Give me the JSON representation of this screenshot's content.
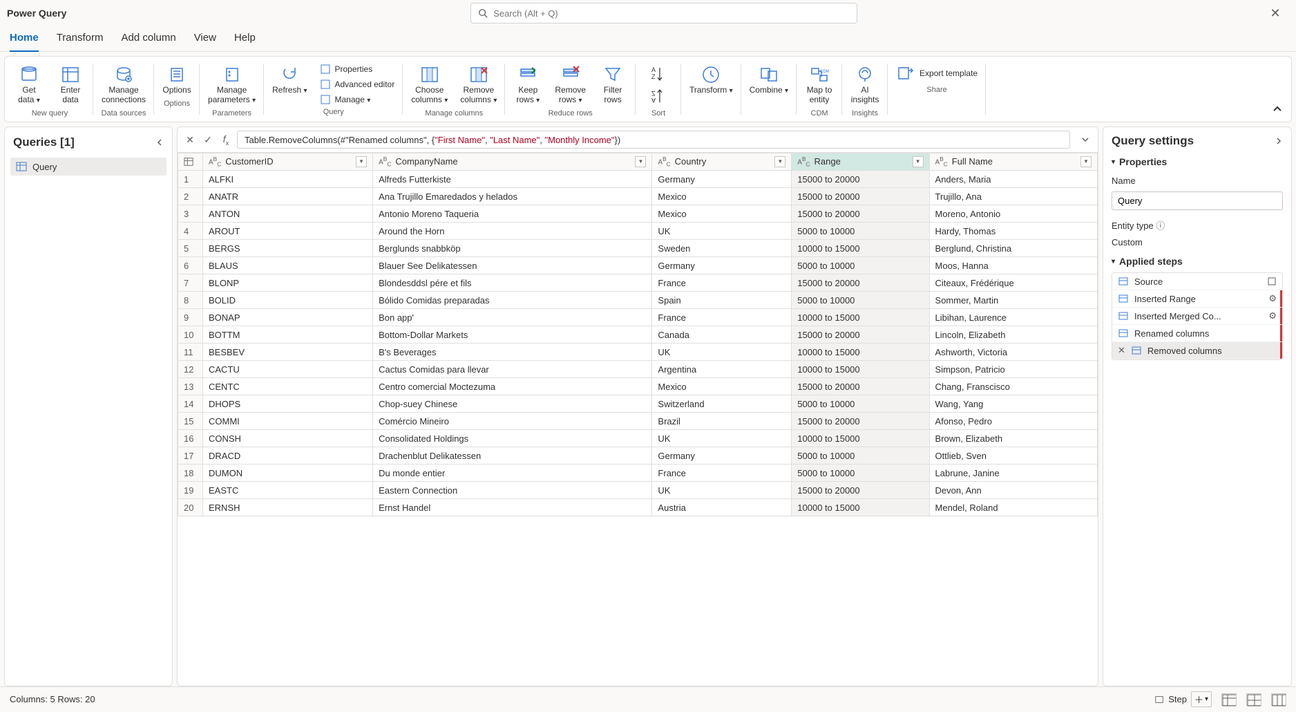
{
  "app": {
    "title": "Power Query",
    "searchPlaceholder": "Search (Alt + Q)"
  },
  "tabs": [
    "Home",
    "Transform",
    "Add column",
    "View",
    "Help"
  ],
  "activeTab": 0,
  "ribbon": {
    "groups": [
      {
        "label": "New query",
        "buttons": [
          {
            "label": "Get\ndata",
            "caret": true
          },
          {
            "label": "Enter\ndata"
          }
        ]
      },
      {
        "label": "Data sources",
        "buttons": [
          {
            "label": "Manage\nconnections"
          }
        ]
      },
      {
        "label": "Options",
        "buttons": [
          {
            "label": "Options"
          }
        ]
      },
      {
        "label": "Parameters",
        "buttons": [
          {
            "label": "Manage\nparameters",
            "caret": true
          }
        ]
      },
      {
        "label": "Query",
        "buttons": [
          {
            "label": "Refresh",
            "caret": true
          }
        ],
        "stack": [
          "Properties",
          "Advanced editor",
          "Manage"
        ]
      },
      {
        "label": "Manage columns",
        "buttons": [
          {
            "label": "Choose\ncolumns",
            "caret": true
          },
          {
            "label": "Remove\ncolumns",
            "caret": true
          }
        ]
      },
      {
        "label": "Reduce rows",
        "buttons": [
          {
            "label": "Keep\nrows",
            "caret": true
          },
          {
            "label": "Remove\nrows",
            "caret": true
          },
          {
            "label": "Filter\nrows"
          }
        ]
      },
      {
        "label": "Sort",
        "buttons": [
          {
            "label": ""
          }
        ]
      },
      {
        "label": "",
        "buttons": [
          {
            "label": "Transform",
            "caret": true
          }
        ]
      },
      {
        "label": "",
        "buttons": [
          {
            "label": "Combine",
            "caret": true
          }
        ]
      },
      {
        "label": "CDM",
        "buttons": [
          {
            "label": "Map to\nentity"
          }
        ]
      },
      {
        "label": "Insights",
        "buttons": [
          {
            "label": "AI\ninsights"
          }
        ]
      },
      {
        "label": "Share",
        "small": "Export template"
      }
    ]
  },
  "queries": {
    "header": "Queries [1]",
    "items": [
      "Query"
    ]
  },
  "formula": {
    "prefix": "Table.RemoveColumns(#\"Renamed columns\", {",
    "args": [
      "\"First Name\"",
      "\"Last Name\"",
      "\"Monthly Income\""
    ],
    "suffix": "})"
  },
  "columns": [
    {
      "name": "CustomerID",
      "type": "ABC"
    },
    {
      "name": "CompanyName",
      "type": "ABC"
    },
    {
      "name": "Country",
      "type": "ABC"
    },
    {
      "name": "Range",
      "type": "ABC",
      "selected": true
    },
    {
      "name": "Full Name",
      "type": "ABC"
    }
  ],
  "rows": [
    [
      "ALFKI",
      "Alfreds Futterkiste",
      "Germany",
      "15000 to 20000",
      "Anders, Maria"
    ],
    [
      "ANATR",
      "Ana Trujillo Emaredados y helados",
      "Mexico",
      "15000 to 20000",
      "Trujillo, Ana"
    ],
    [
      "ANTON",
      "Antonio Moreno Taqueria",
      "Mexico",
      "15000 to 20000",
      "Moreno, Antonio"
    ],
    [
      "AROUT",
      "Around the Horn",
      "UK",
      "5000 to 10000",
      "Hardy, Thomas"
    ],
    [
      "BERGS",
      "Berglunds snabbköp",
      "Sweden",
      "10000 to 15000",
      "Berglund, Christina"
    ],
    [
      "BLAUS",
      "Blauer See Delikatessen",
      "Germany",
      "5000 to 10000",
      "Moos, Hanna"
    ],
    [
      "BLONP",
      "Blondesddsl pére et fils",
      "France",
      "15000 to 20000",
      "Citeaux, Frédérique"
    ],
    [
      "BOLID",
      "Bólido Comidas preparadas",
      "Spain",
      "5000 to 10000",
      "Sommer, Martin"
    ],
    [
      "BONAP",
      "Bon app'",
      "France",
      "10000 to 15000",
      "Libihan, Laurence"
    ],
    [
      "BOTTM",
      "Bottom-Dollar Markets",
      "Canada",
      "15000 to 20000",
      "Lincoln, Elizabeth"
    ],
    [
      "BESBEV",
      "B's Beverages",
      "UK",
      "10000 to 15000",
      "Ashworth, Victoria"
    ],
    [
      "CACTU",
      "Cactus Comidas para llevar",
      "Argentina",
      "10000 to 15000",
      "Simpson, Patricio"
    ],
    [
      "CENTC",
      "Centro comercial Moctezuma",
      "Mexico",
      "15000 to 20000",
      "Chang, Franscisco"
    ],
    [
      "DHOPS",
      "Chop-suey Chinese",
      "Switzerland",
      "5000 to 10000",
      "Wang, Yang"
    ],
    [
      "COMMI",
      "Comércio Mineiro",
      "Brazil",
      "15000 to 20000",
      "Afonso, Pedro"
    ],
    [
      "CONSH",
      "Consolidated Holdings",
      "UK",
      "10000 to 15000",
      "Brown, Elizabeth"
    ],
    [
      "DRACD",
      "Drachenblut Delikatessen",
      "Germany",
      "5000 to 10000",
      "Ottlieb, Sven"
    ],
    [
      "DUMON",
      "Du monde entier",
      "France",
      "5000 to 10000",
      "Labrune, Janine"
    ],
    [
      "EASTC",
      "Eastern Connection",
      "UK",
      "15000 to 20000",
      "Devon, Ann"
    ],
    [
      "ERNSH",
      "Ernst Handel",
      "Austria",
      "10000 to 15000",
      "Mendel, Roland"
    ]
  ],
  "settings": {
    "title": "Query settings",
    "properties": "Properties",
    "nameLabel": "Name",
    "nameValue": "Query",
    "entityTypeLabel": "Entity type",
    "entityTypeValue": "Custom",
    "appliedStepsLabel": "Applied steps",
    "steps": [
      {
        "name": "Source",
        "gear": false,
        "bar": ""
      },
      {
        "name": "Inserted Range",
        "gear": true,
        "bar": "red"
      },
      {
        "name": "Inserted Merged Co...",
        "gear": true,
        "bar": "red"
      },
      {
        "name": "Renamed columns",
        "gear": false,
        "bar": "red"
      },
      {
        "name": "Removed columns",
        "gear": false,
        "bar": "red",
        "active": true,
        "delete": true
      }
    ]
  },
  "status": {
    "left": "Columns: 5   Rows: 20",
    "step": "Step"
  }
}
